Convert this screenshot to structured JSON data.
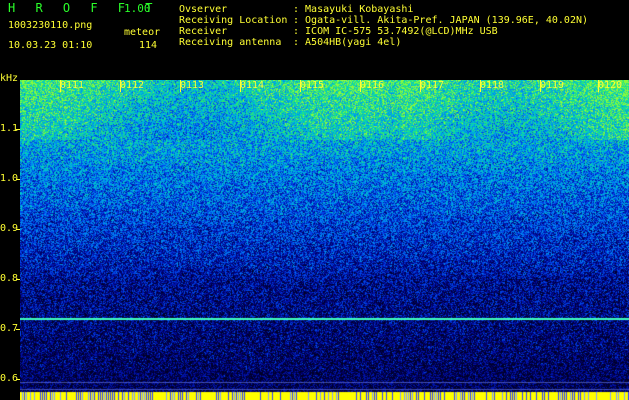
{
  "header": {
    "app_title": "H R O F F T",
    "app_version": "1.00",
    "file_name": "1003230110.png",
    "timestamp": "10.03.23 01:10",
    "meteor_label": "meteor",
    "meteor_count": "114"
  },
  "info": [
    {
      "key": "Ovserver",
      "value": ": Masayuki Kobayashi"
    },
    {
      "key": "Receiving Location",
      "value": ": Ogata-vill. Akita-Pref. JAPAN (139.96E, 40.02N)"
    },
    {
      "key": "Receiver",
      "value": ": ICOM IC-575 53.7492(@LCD)MHz USB"
    },
    {
      "key": "Receiving antenna",
      "value": ": A504HB(yagi 4el)"
    }
  ],
  "y_axis": {
    "unit": "kHz",
    "ticks": [
      "1.1",
      "1.0",
      "0.9",
      "0.8",
      "0.7",
      "0.6"
    ]
  },
  "time_labels": [
    "0111",
    "0112",
    "0113",
    "0114",
    "0115",
    "0116",
    "0117",
    "0118",
    "0119",
    "0120"
  ],
  "spectrogram": {
    "freq_range_khz": [
      0.585,
      1.185
    ],
    "echo_line_khz": 0.738,
    "faint_lines_khz": [
      0.618,
      0.605
    ],
    "colors": {
      "background": "#000000",
      "text": "#ffff33",
      "title": "#2aff2a",
      "echo_line": "#40ffc0",
      "baseline": "#ffff00"
    }
  }
}
